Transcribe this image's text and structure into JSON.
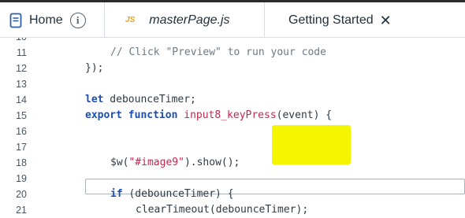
{
  "tabs": {
    "home": {
      "label": "Home",
      "icon": "file-icon",
      "info_icon": "i"
    },
    "master": {
      "badge": "JS",
      "label": "masterPage.js"
    },
    "getting": {
      "label": "Getting Started",
      "close": "✕"
    }
  },
  "editor": {
    "highlight_color": "#f5f500",
    "lines": [
      {
        "num": "10",
        "text": ""
      },
      {
        "num": "11",
        "text": "    // Click \"Preview\" to run your code"
      },
      {
        "num": "12",
        "text": "});"
      },
      {
        "num": "13",
        "text": ""
      },
      {
        "num": "14",
        "text": "let debounceTimer;"
      },
      {
        "num": "15",
        "text": "export function input8_keyPress(event) {"
      },
      {
        "num": "16",
        "text": ""
      },
      {
        "num": "17",
        "text": ""
      },
      {
        "num": "18",
        "text": "    $w(\"#image9\").show();"
      },
      {
        "num": "19",
        "text": ""
      },
      {
        "num": "20",
        "text": "    if (debounceTimer) {"
      },
      {
        "num": "21",
        "text": "        clearTimeout(debounceTimer);"
      }
    ],
    "tokens": {
      "l11_comment": "// Click \"Preview\" to run your code",
      "l12": "});",
      "l14_kw": "let",
      "l14_rest": " debounceTimer;",
      "l15_kw1": "export",
      "l15_kw2": "function",
      "l15_fn": "input8_keyPress",
      "l15_rest": "(event) {",
      "l18_a": "$w(",
      "l18_str": "\"#image9\"",
      "l18_b": ").show();",
      "l20_kw": "if",
      "l20_rest": " (debounceTimer) {",
      "l21": "clearTimeout(debounceTimer);"
    }
  }
}
